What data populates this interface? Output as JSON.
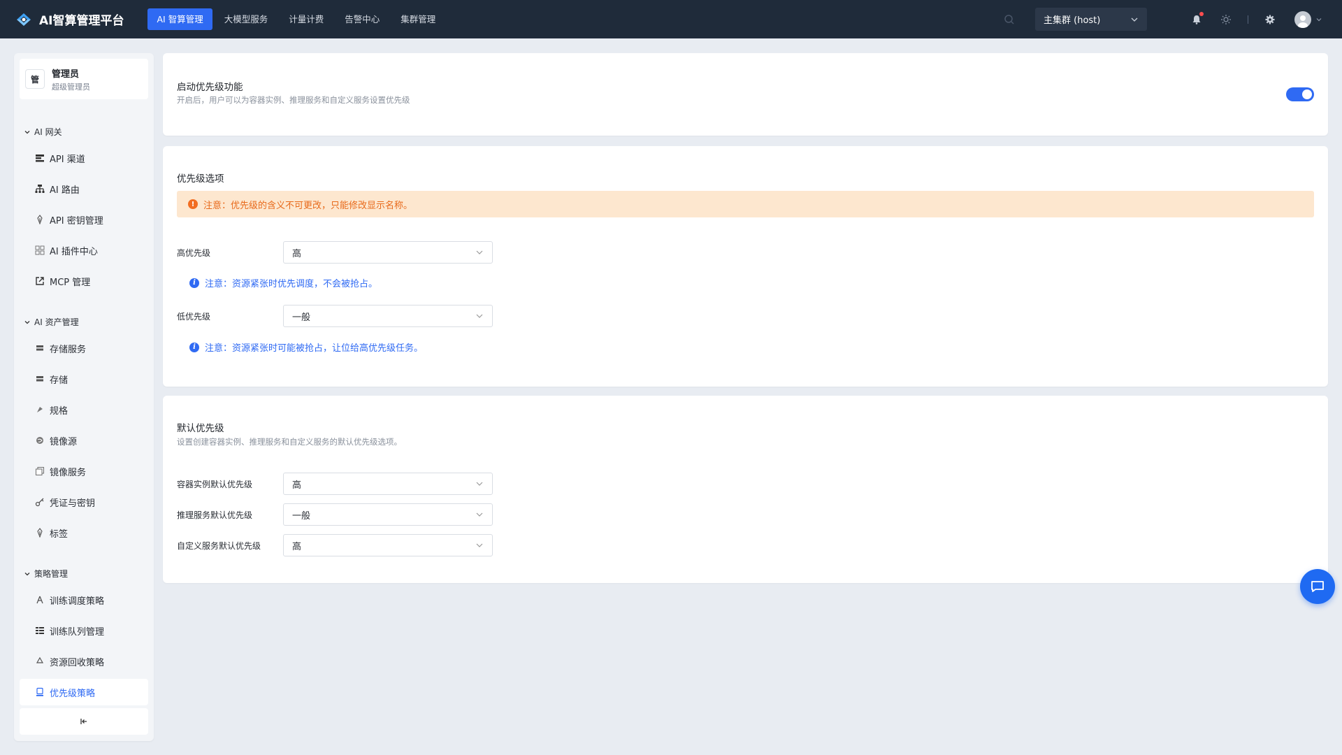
{
  "app": {
    "title": "AI智算管理平台"
  },
  "nav": {
    "items": [
      {
        "label": "AI 智算管理",
        "active": true
      },
      {
        "label": "大模型服务",
        "active": false
      },
      {
        "label": "计量计费",
        "active": false
      },
      {
        "label": "告警中心",
        "active": false
      },
      {
        "label": "集群管理",
        "active": false
      }
    ]
  },
  "header": {
    "cluster": "主集群 (host)"
  },
  "user": {
    "badge": "管",
    "name": "管理员",
    "role": "超级管理员"
  },
  "sidebar": {
    "sections": [
      {
        "title": "AI 网关"
      },
      {
        "title": "AI 资产管理"
      },
      {
        "title": "策略管理"
      }
    ],
    "items": [
      {
        "label": "API 渠道",
        "icon": "api-channel-icon"
      },
      {
        "label": "AI 路由",
        "icon": "route-icon"
      },
      {
        "label": "API 密钥管理",
        "icon": "key-icon"
      },
      {
        "label": "AI 插件中心",
        "icon": "grid-icon"
      },
      {
        "label": "MCP 管理",
        "icon": "external-link-icon"
      },
      {
        "label": "存储服务",
        "icon": "storage-icon"
      },
      {
        "label": "存储",
        "icon": "storage-icon"
      },
      {
        "label": "规格",
        "icon": "spec-icon"
      },
      {
        "label": "镜像源",
        "icon": "globe-icon"
      },
      {
        "label": "镜像服务",
        "icon": "image-icon"
      },
      {
        "label": "凭证与密钥",
        "icon": "key-icon"
      },
      {
        "label": "标签",
        "icon": "tag-icon"
      },
      {
        "label": "训练调度策略",
        "icon": "schedule-icon"
      },
      {
        "label": "训练队列管理",
        "icon": "queue-icon"
      },
      {
        "label": "资源回收策略",
        "icon": "recycle-icon"
      },
      {
        "label": "优先级策略",
        "icon": "priority-icon",
        "active": true
      }
    ],
    "collapse_icon": "collapse-icon"
  },
  "enable_card": {
    "title": "启动优先级功能",
    "desc": "开启后，用户可以为容器实例、推理服务和自定义服务设置优先级",
    "enabled": true
  },
  "options_card": {
    "title": "优先级选项",
    "warning": "注意：优先级的含义不可更改，只能修改显示名称。",
    "high": {
      "label": "高优先级",
      "value": "高",
      "note": "注意：资源紧张时优先调度，不会被抢占。"
    },
    "low": {
      "label": "低优先级",
      "value": "一般",
      "note": "注意：资源紧张时可能被抢占，让位给高优先级任务。"
    }
  },
  "default_card": {
    "title": "默认优先级",
    "desc": "设置创建容器实例、推理服务和自定义服务的默认优先级选项。",
    "fields": [
      {
        "label": "容器实例默认优先级",
        "value": "高"
      },
      {
        "label": "推理服务默认优先级",
        "value": "一般"
      },
      {
        "label": "自定义服务默认优先级",
        "value": "高"
      }
    ]
  },
  "colors": {
    "primary": "#2f6af3",
    "topbar": "#1f2b3a",
    "warning_bg": "#fde7cf",
    "warning_text": "#e86a1b"
  }
}
